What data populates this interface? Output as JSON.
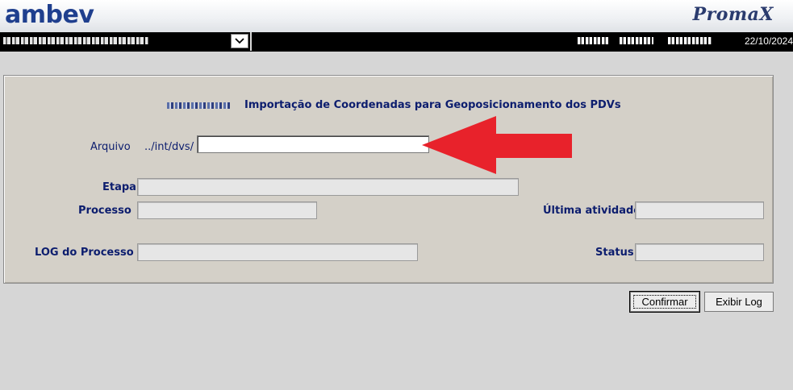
{
  "header": {
    "logo_text": "ambev",
    "brand_text": "PromaX"
  },
  "topbar": {
    "unit_value": "",
    "user_info": "",
    "date": "22/10/2024"
  },
  "form": {
    "title": "Importação de Coordenadas para Geoposicionamento dos PDVs",
    "labels": {
      "arquivo": "Arquivo",
      "path_prefix": "../int/dvs/",
      "etapa": "Etapa",
      "processo": "Processo",
      "ultima_atividade": "Última atividade",
      "log_processo": "LOG do Processo",
      "status": "Status"
    },
    "values": {
      "arquivo": "",
      "etapa": "",
      "processo": "",
      "ultima_atividade": "",
      "log_processo": "",
      "status": ""
    }
  },
  "buttons": {
    "confirmar": "Confirmar",
    "exibir_log": "Exibir Log"
  },
  "colors": {
    "label": "#0c1d6e",
    "panel": "#d4d0c8",
    "annotation_arrow": "#e8222b"
  },
  "icons": {
    "dropdown": "chevron-down-icon",
    "annotation": "red-arrow-icon"
  }
}
